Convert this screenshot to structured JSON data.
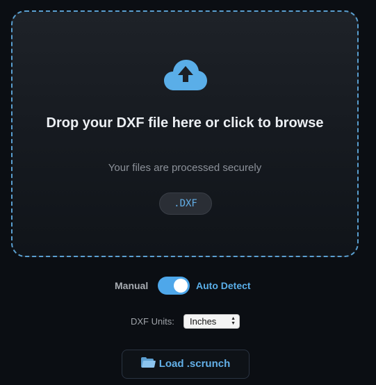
{
  "dropzone": {
    "icon": "cloud-upload-icon",
    "title": "Drop your DXF file here or click to browse",
    "subtitle": "Your files are processed securely",
    "extension_badge": ".DXF"
  },
  "mode_toggle": {
    "left_label": "Manual",
    "right_label": "Auto Detect",
    "state": "Auto Detect",
    "accent_color": "#4ea7ea"
  },
  "units": {
    "label": "DXF Units:",
    "selected": "Inches"
  },
  "load_button": {
    "icon": "folder-icon",
    "label": "Load .scrunch"
  },
  "colors": {
    "accent": "#5aaee8",
    "background": "#0b0e13",
    "dashed_border": "#5a9fd0"
  }
}
